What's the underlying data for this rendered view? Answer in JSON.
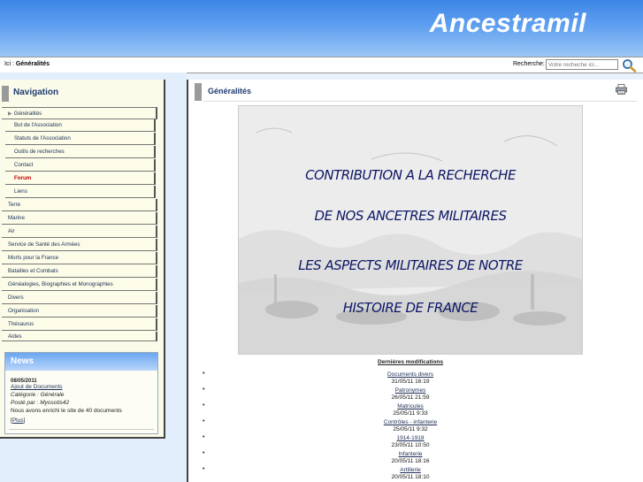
{
  "header": {
    "site_title": "Ancestramil"
  },
  "topbar": {
    "crumb_prefix": "Ici : ",
    "crumb_current": "Généralités",
    "search_label": "Recherche:",
    "search_placeholder": "Votre recheche ici..."
  },
  "nav": {
    "title": "Navigation",
    "items": [
      {
        "label": "Généralités"
      },
      {
        "label": "But de l'Association"
      },
      {
        "label": "Statuts de l'Association"
      },
      {
        "label": "Outils de recherches"
      },
      {
        "label": "Contact"
      },
      {
        "label": "Forum"
      },
      {
        "label": "Liens"
      },
      {
        "label": "Terre"
      },
      {
        "label": "Marine"
      },
      {
        "label": "Air"
      },
      {
        "label": "Service de Santé des Armées"
      },
      {
        "label": "Morts pour la France"
      },
      {
        "label": "Batailles et Combats"
      },
      {
        "label": "Généalogies, Biographies et Monographies"
      },
      {
        "label": "Divers"
      },
      {
        "label": "Organisation"
      },
      {
        "label": "Thésaurus"
      },
      {
        "label": "Aides"
      }
    ]
  },
  "news": {
    "title": "News",
    "date": "08/05/2011",
    "link": "Ajout de Documents",
    "category": "Catégorie : Générale",
    "poster": "Posté par : Myosotis42",
    "text": "Nous avons enrichi le site de 40 documents",
    "more_open": "[",
    "more": "Plus",
    "more_close": "]"
  },
  "main": {
    "title": "Généralités",
    "banner_lines": [
      "CONTRIBUTION A LA RECHERCHE",
      "DE NOS ANCETRES MILITAIRES",
      "LES ASPECTS MILITAIRES DE NOTRE",
      "HISTOIRE DE FRANCE"
    ],
    "mods_title": "Dernières modifications",
    "modifications": [
      {
        "label": "Documents divers",
        "date": "31/05/11 16:19"
      },
      {
        "label": "Patronymes",
        "date": "26/05/11 21:59"
      },
      {
        "label": "Matricules",
        "date": "25/05/11 9:33"
      },
      {
        "label": "Contrôles - infanterie",
        "date": "25/05/11 9:32"
      },
      {
        "label": "1914-1918",
        "date": "23/05/11 10:50"
      },
      {
        "label": "Infanterie",
        "date": "20/05/11 18:16"
      },
      {
        "label": "Artillerie",
        "date": "20/05/11 18:10"
      }
    ]
  },
  "icons": {
    "search": "magnifier-icon",
    "print": "printer-icon",
    "nav_arrow": "arrow-right-icon"
  },
  "colors": {
    "header_blue": "#3d86e6",
    "nav_text": "#1b2e55",
    "forum_red": "#c00000",
    "banner_text": "#0d1766"
  }
}
